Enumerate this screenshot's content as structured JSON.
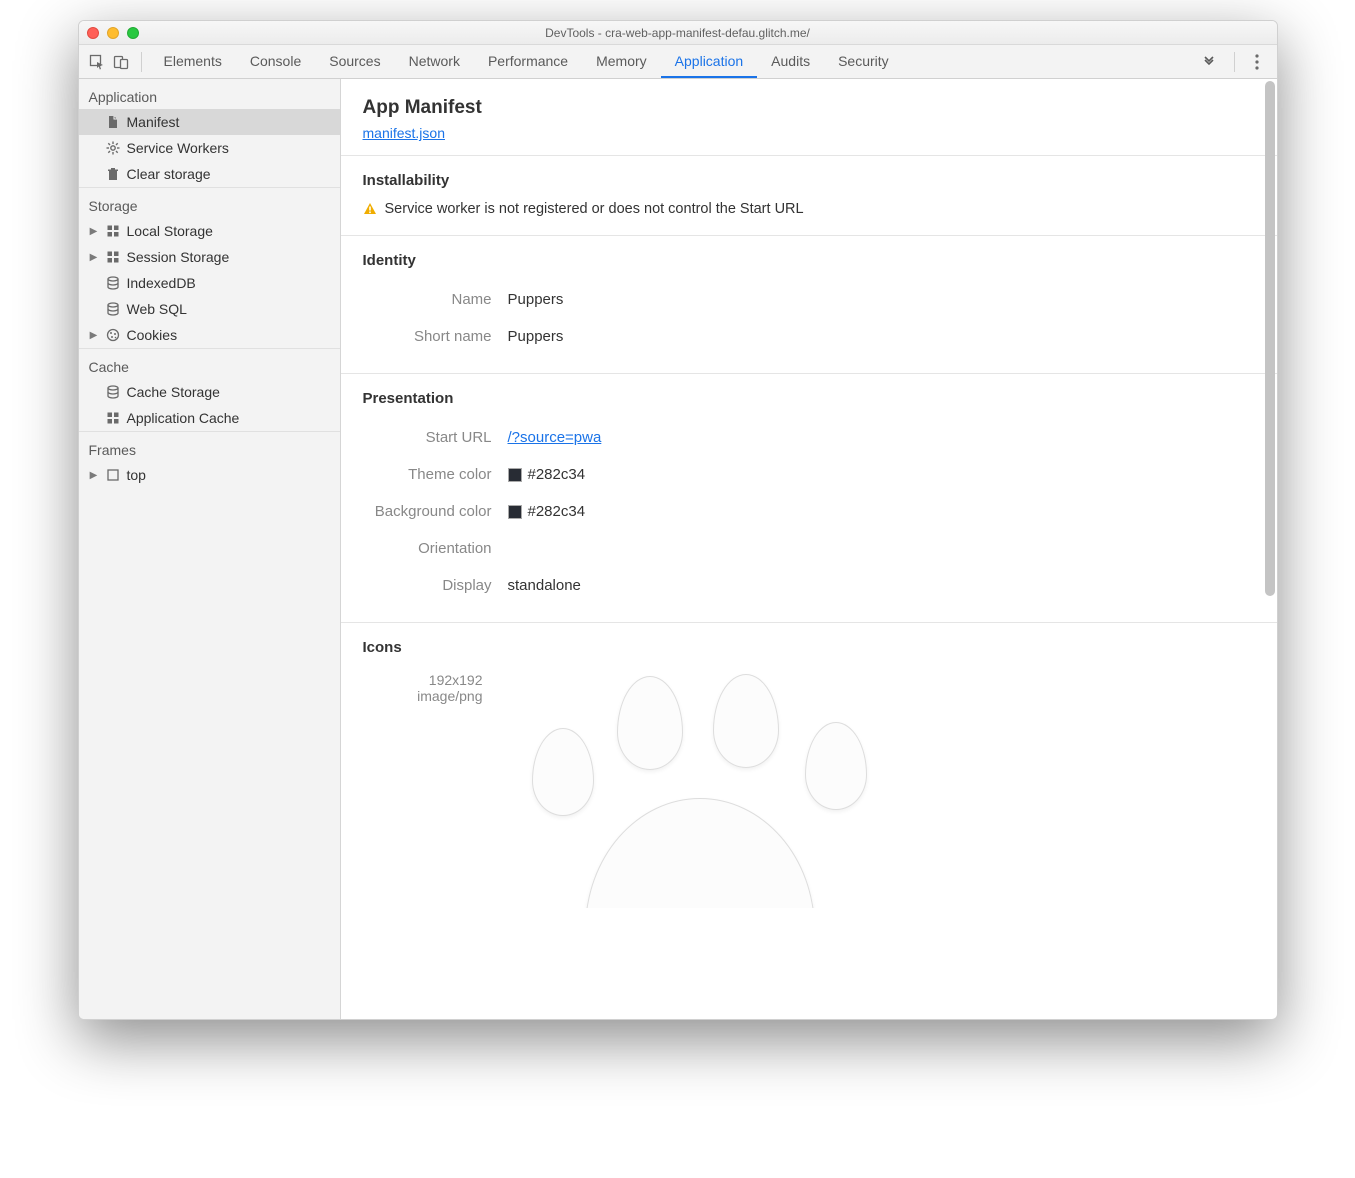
{
  "window": {
    "title": "DevTools - cra-web-app-manifest-defau.glitch.me/"
  },
  "tabs": {
    "items": [
      "Elements",
      "Console",
      "Sources",
      "Network",
      "Performance",
      "Memory",
      "Application",
      "Audits",
      "Security"
    ],
    "active": "Application"
  },
  "sidebar": {
    "groups": [
      {
        "title": "Application",
        "items": [
          {
            "label": "Manifest",
            "icon": "file-icon",
            "selected": true
          },
          {
            "label": "Service Workers",
            "icon": "gear-icon"
          },
          {
            "label": "Clear storage",
            "icon": "trash-icon"
          }
        ]
      },
      {
        "title": "Storage",
        "items": [
          {
            "label": "Local Storage",
            "icon": "grid-icon",
            "expandable": true
          },
          {
            "label": "Session Storage",
            "icon": "grid-icon",
            "expandable": true
          },
          {
            "label": "IndexedDB",
            "icon": "database-icon"
          },
          {
            "label": "Web SQL",
            "icon": "database-icon"
          },
          {
            "label": "Cookies",
            "icon": "cookie-icon",
            "expandable": true
          }
        ]
      },
      {
        "title": "Cache",
        "items": [
          {
            "label": "Cache Storage",
            "icon": "database-icon"
          },
          {
            "label": "Application Cache",
            "icon": "grid-icon"
          }
        ]
      },
      {
        "title": "Frames",
        "items": [
          {
            "label": "top",
            "icon": "frame-icon",
            "expandable": true
          }
        ]
      }
    ]
  },
  "manifest": {
    "title": "App Manifest",
    "link": "manifest.json",
    "installability": {
      "title": "Installability",
      "warning": "Service worker is not registered or does not control the Start URL"
    },
    "identity": {
      "title": "Identity",
      "name_label": "Name",
      "name_value": "Puppers",
      "shortname_label": "Short name",
      "shortname_value": "Puppers"
    },
    "presentation": {
      "title": "Presentation",
      "starturl_label": "Start URL",
      "starturl_value": "/?source=pwa",
      "themecolor_label": "Theme color",
      "themecolor_value": "#282c34",
      "bgcolor_label": "Background color",
      "bgcolor_value": "#282c34",
      "orientation_label": "Orientation",
      "orientation_value": "",
      "display_label": "Display",
      "display_value": "standalone"
    },
    "icons": {
      "title": "Icons",
      "size": "192x192",
      "mime": "image/png"
    }
  }
}
